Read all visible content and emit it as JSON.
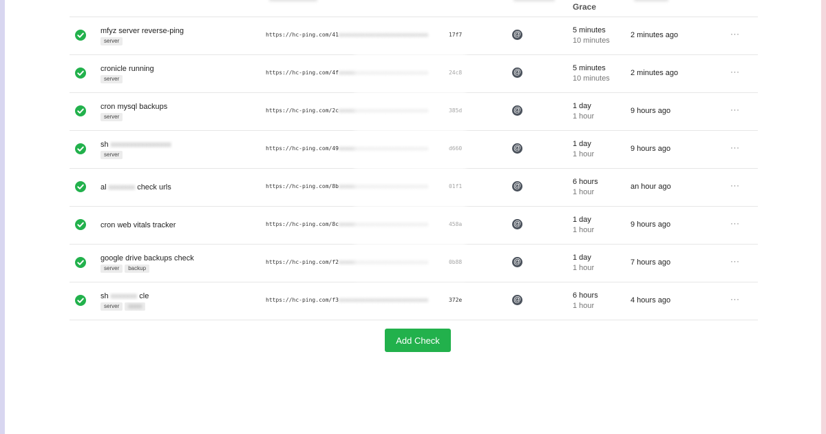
{
  "header": {
    "grace_label": "Grace"
  },
  "checks": [
    {
      "name": "mfyz server reverse-ping",
      "name_blurred": false,
      "tags": [
        "server"
      ],
      "url_start": "https://hc-ping.com/41",
      "url_end": "17f7",
      "integration_icon": "@",
      "period": "5 minutes",
      "grace": "10 minutes",
      "last_ping": "2 minutes ago",
      "status": "up"
    },
    {
      "name": "cronicle running",
      "name_blurred": false,
      "tags": [
        "server"
      ],
      "url_start": "https://hc-ping.com/4f",
      "url_end": "24c8",
      "integration_icon": "@",
      "period": "5 minutes",
      "grace": "10 minutes",
      "last_ping": "2 minutes ago",
      "status": "up"
    },
    {
      "name": "cron mysql backups",
      "name_blurred": false,
      "tags": [
        "server"
      ],
      "url_start": "https://hc-ping.com/2c",
      "url_end": "385d",
      "integration_icon": "@",
      "period": "1 day",
      "grace": "1 hour",
      "last_ping": "9 hours ago",
      "status": "up"
    },
    {
      "name": "sh",
      "name_blurred": true,
      "tags": [
        "server"
      ],
      "url_start": "https://hc-ping.com/49",
      "url_end": "d660",
      "integration_icon": "@",
      "period": "1 day",
      "grace": "1 hour",
      "last_ping": "9 hours ago",
      "status": "up"
    },
    {
      "name": "al",
      "name_suffix": "check urls",
      "name_blurred": true,
      "tags": [],
      "url_start": "https://hc-ping.com/8b",
      "url_end": "01f1",
      "integration_icon": "@",
      "period": "6 hours",
      "grace": "1 hour",
      "last_ping": "an hour ago",
      "status": "up"
    },
    {
      "name": "cron web vitals tracker",
      "name_blurred": false,
      "tags": [],
      "url_start": "https://hc-ping.com/8c",
      "url_end": "458a",
      "integration_icon": "@",
      "period": "1 day",
      "grace": "1 hour",
      "last_ping": "9 hours ago",
      "status": "up"
    },
    {
      "name": "google drive backups check",
      "name_blurred": false,
      "tags": [
        "server",
        "backup"
      ],
      "url_start": "https://hc-ping.com/f2",
      "url_end": "0b88",
      "integration_icon": "@",
      "period": "1 day",
      "grace": "1 hour",
      "last_ping": "7 hours ago",
      "status": "up"
    },
    {
      "name": "sh",
      "name_suffix": "cle",
      "name_blurred": true,
      "tags": [
        "server"
      ],
      "url_start": "https://hc-ping.com/f3",
      "url_end": "372e",
      "integration_icon": "@",
      "period": "6 hours",
      "grace": "1 hour",
      "last_ping": "4 hours ago",
      "status": "up"
    }
  ],
  "row_menu_label": "···",
  "add_check_label": "Add Check",
  "colors": {
    "status_up": "#22b14c",
    "button_bg": "#22b14c",
    "integration_bg": "#4c535d"
  }
}
